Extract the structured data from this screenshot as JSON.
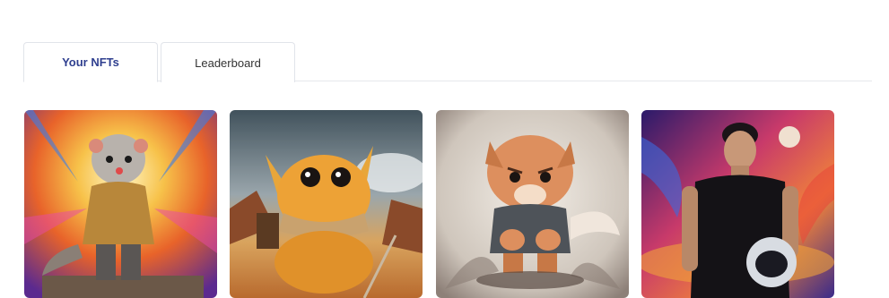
{
  "tabs": [
    {
      "label": "Your NFTs",
      "active": true
    },
    {
      "label": "Leaderboard",
      "active": false
    }
  ],
  "nfts": [
    {
      "image": "meerkat-adventurer-art",
      "palette": [
        "#f07a2a",
        "#3a6de0",
        "#f5d04a"
      ]
    },
    {
      "image": "fluffy-orange-creature-art",
      "palette": [
        "#e8a63a",
        "#6b7f8f",
        "#c46b2e"
      ]
    },
    {
      "image": "angry-fluffy-kitten-art",
      "palette": [
        "#d99067",
        "#e9e4de",
        "#5a4c45"
      ]
    },
    {
      "image": "man-with-space-helmet-art",
      "palette": [
        "#3b1c7a",
        "#e04a4a",
        "#f0a23a"
      ]
    }
  ]
}
